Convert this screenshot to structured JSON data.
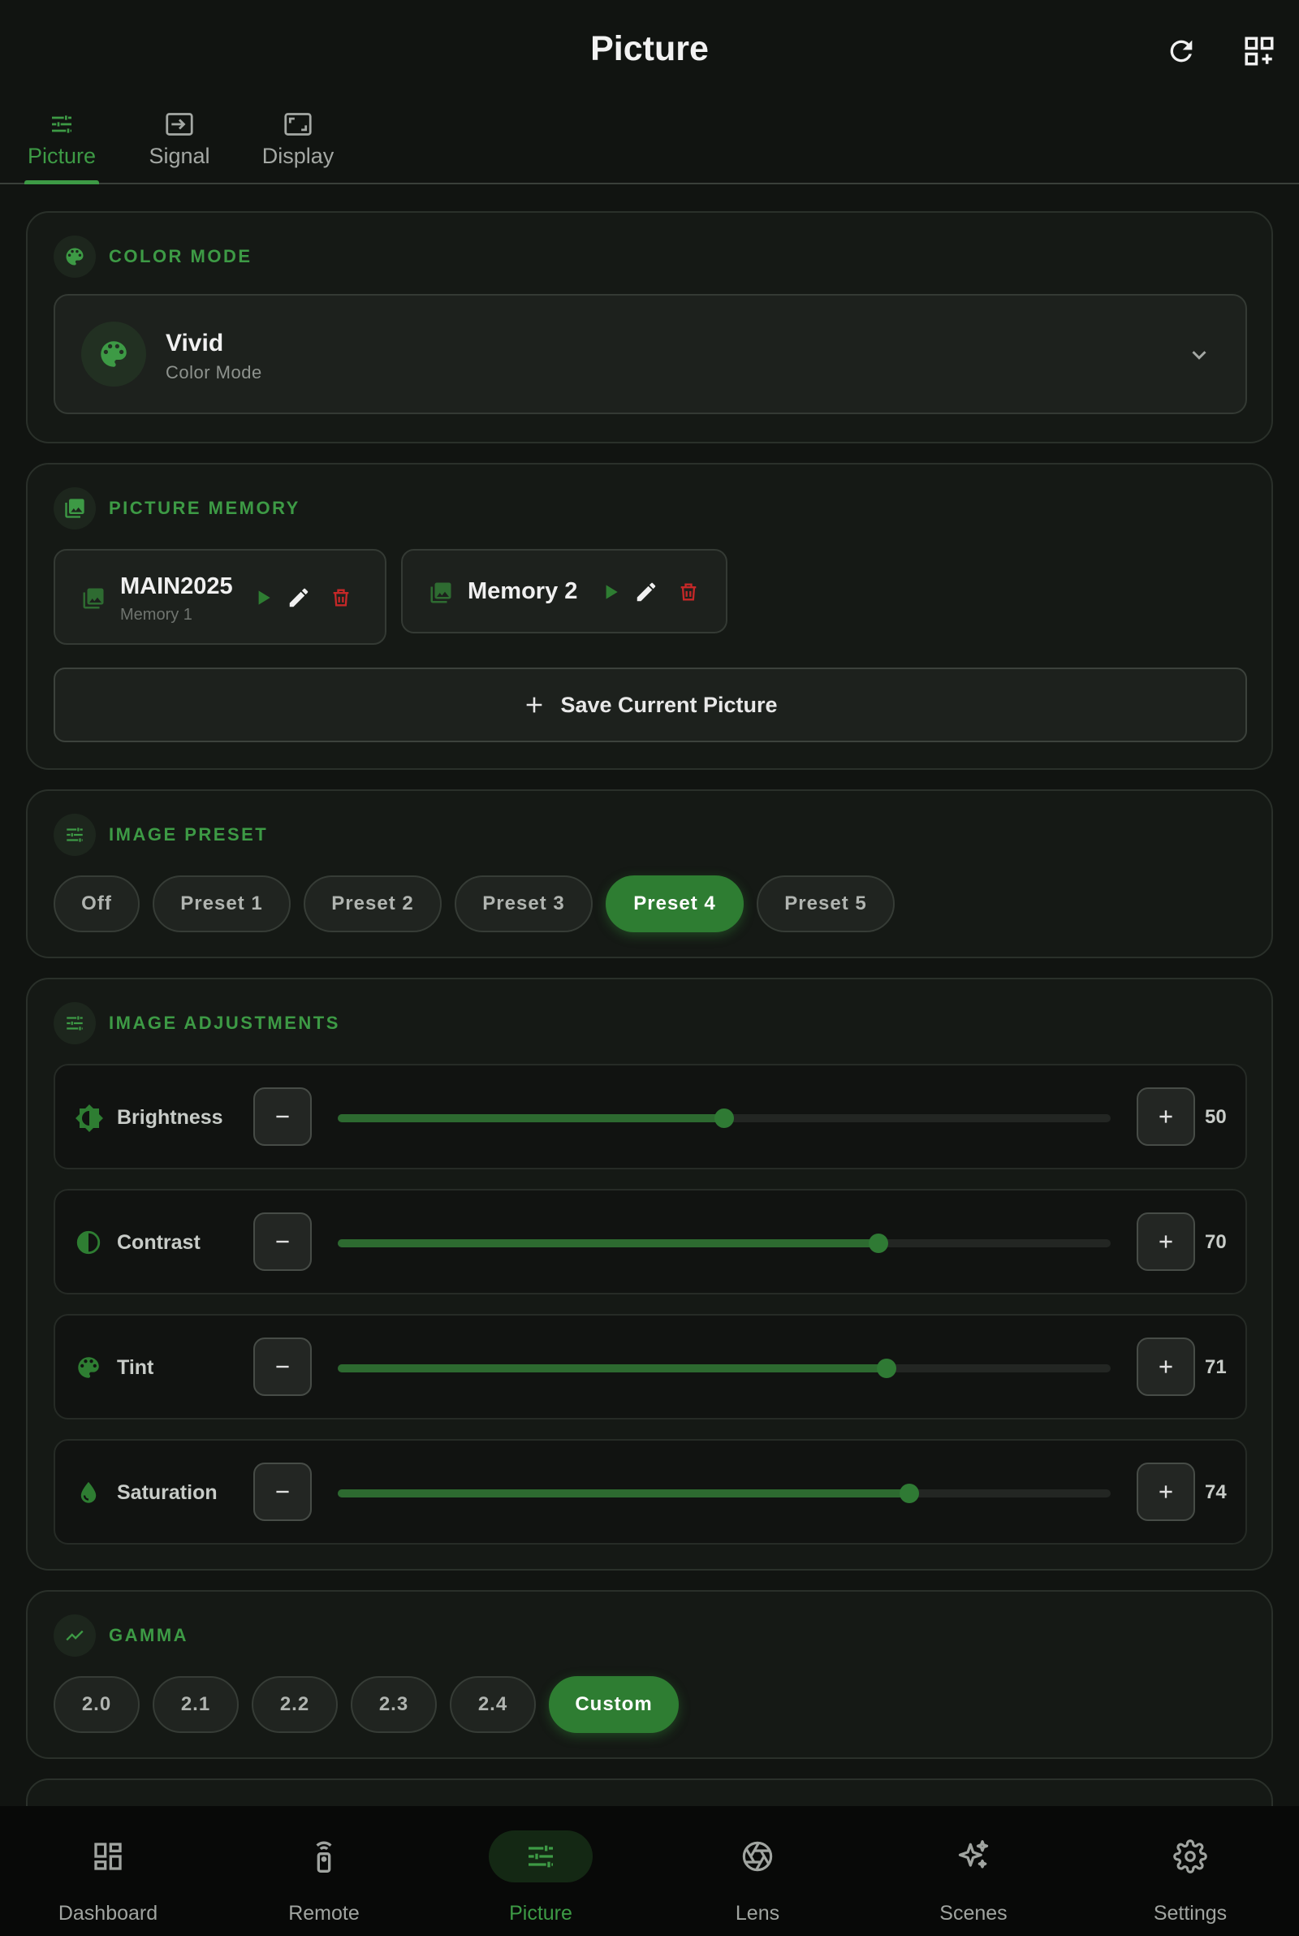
{
  "header": {
    "title": "Picture"
  },
  "tabs": [
    {
      "label": "Picture",
      "icon": "tune-icon",
      "active": true
    },
    {
      "label": "Signal",
      "icon": "input-icon",
      "active": false
    },
    {
      "label": "Display",
      "icon": "aspect-ratio-icon",
      "active": false
    }
  ],
  "color_mode": {
    "heading": "COLOR MODE",
    "selected": "Vivid",
    "sub_label": "Color Mode"
  },
  "picture_memory": {
    "heading": "PICTURE MEMORY",
    "memories": [
      {
        "name": "MAIN2025",
        "sub": "Memory 1"
      },
      {
        "name": "Memory 2"
      }
    ],
    "save_label": "Save Current Picture"
  },
  "image_preset": {
    "heading": "IMAGE PRESET",
    "options": [
      "Off",
      "Preset 1",
      "Preset 2",
      "Preset 3",
      "Preset 4",
      "Preset 5"
    ],
    "selected": "Preset 4"
  },
  "image_adjustments": {
    "heading": "IMAGE ADJUSTMENTS",
    "sliders": [
      {
        "label": "Brightness",
        "value": 50,
        "icon": "brightness-icon"
      },
      {
        "label": "Contrast",
        "value": 70,
        "icon": "contrast-icon"
      },
      {
        "label": "Tint",
        "value": 71,
        "icon": "palette-icon"
      },
      {
        "label": "Saturation",
        "value": 74,
        "icon": "drop-icon"
      }
    ],
    "range": [
      0,
      100
    ]
  },
  "gamma": {
    "heading": "GAMMA",
    "options": [
      "2.0",
      "2.1",
      "2.2",
      "2.3",
      "2.4",
      "Custom"
    ],
    "selected": "Custom"
  },
  "bottom_nav": [
    {
      "label": "Dashboard",
      "icon": "dashboard-icon",
      "active": false
    },
    {
      "label": "Remote",
      "icon": "remote-icon",
      "active": false
    },
    {
      "label": "Picture",
      "icon": "tune-icon",
      "active": true
    },
    {
      "label": "Lens",
      "icon": "aperture-icon",
      "active": false
    },
    {
      "label": "Scenes",
      "icon": "sparkle-icon",
      "active": false
    },
    {
      "label": "Settings",
      "icon": "gear-icon",
      "active": false
    }
  ],
  "colors": {
    "accent": "#3d9a45",
    "accent_strong": "#2e7d32",
    "danger": "#c62828",
    "background": "#111411"
  }
}
